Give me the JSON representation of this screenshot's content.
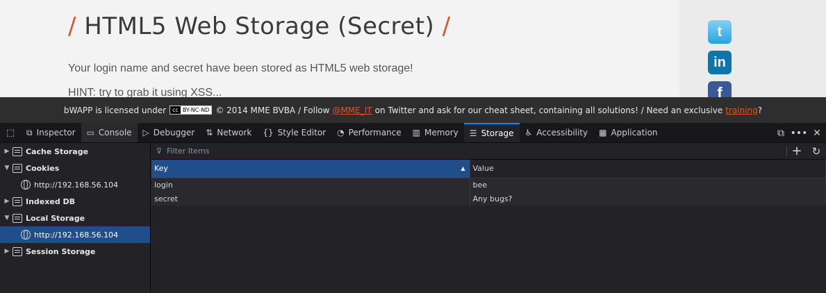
{
  "page": {
    "title_slash": "/",
    "title": "HTML5 Web Storage (Secret)",
    "intro": "Your login name and secret have been stored as HTML5 web storage!",
    "hint": "HINT: try to grab it using XSS...",
    "social": {
      "twitter": "t",
      "linkedin": "in",
      "facebook": "f"
    }
  },
  "footer": {
    "text1": "bWAPP is licensed under",
    "cc_badge": "cc",
    "cc_text": "BY-NC-ND",
    "text2": "© 2014 MME BVBA / Follow",
    "twitter_link": "@MME_IT",
    "text3": "on Twitter and ask for our cheat sheet, containing all solutions! / Need an exclusive",
    "training_link": "training",
    "text4": "?"
  },
  "devtools": {
    "tabs": [
      {
        "label": "Inspector",
        "icon": "⧉"
      },
      {
        "label": "Console",
        "icon": "▭"
      },
      {
        "label": "Debugger",
        "icon": "▷"
      },
      {
        "label": "Network",
        "icon": "⇅"
      },
      {
        "label": "Style Editor",
        "icon": "{}"
      },
      {
        "label": "Performance",
        "icon": "◔"
      },
      {
        "label": "Memory",
        "icon": "▥"
      },
      {
        "label": "Storage",
        "icon": "☰"
      },
      {
        "label": "Accessibility",
        "icon": "♿"
      },
      {
        "label": "Application",
        "icon": "▦"
      }
    ],
    "sidebar": {
      "cache_storage": "Cache Storage",
      "cookies": "Cookies",
      "cookies_host": "http://192.168.56.104",
      "indexed_db": "Indexed DB",
      "local_storage": "Local Storage",
      "local_storage_host": "http://192.168.56.104",
      "session_storage": "Session Storage"
    },
    "filter_placeholder": "Filter Items",
    "table": {
      "headers": [
        "Key",
        "Value"
      ],
      "rows": [
        {
          "key": "login",
          "value": "bee"
        },
        {
          "key": "secret",
          "value": "Any bugs?"
        }
      ]
    }
  }
}
